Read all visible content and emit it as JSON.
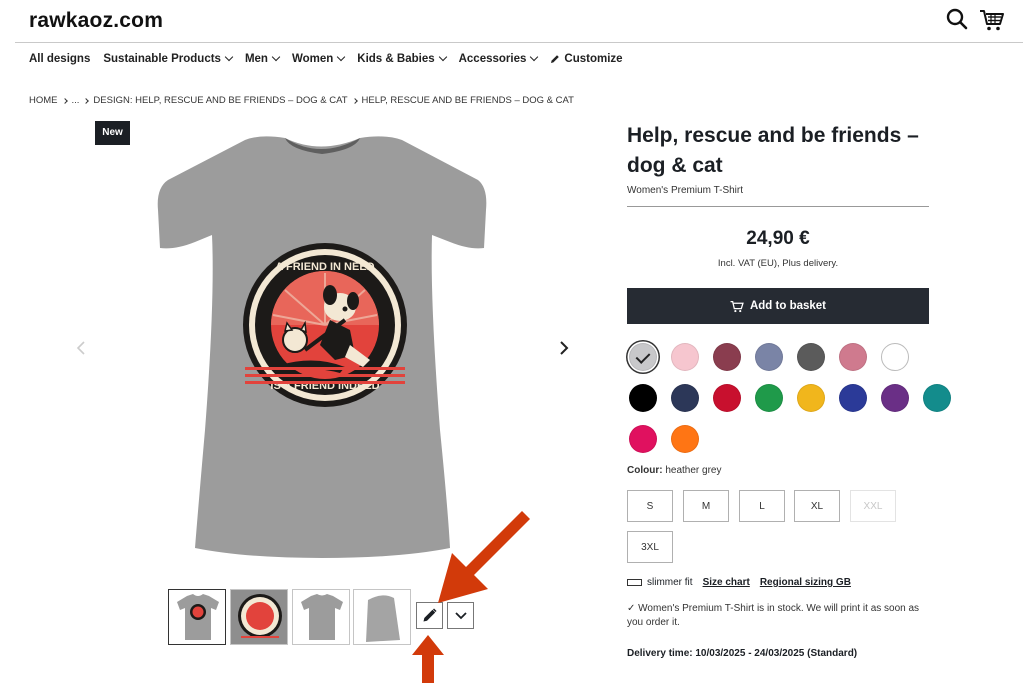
{
  "header": {
    "logo": "rawkaoz.com",
    "search_icon": "search-icon",
    "cart_icon": "cart-icon"
  },
  "nav": {
    "items": [
      {
        "label": "All designs",
        "has_chevron": false
      },
      {
        "label": "Sustainable Products",
        "has_chevron": true
      },
      {
        "label": "Men",
        "has_chevron": true
      },
      {
        "label": "Women",
        "has_chevron": true
      },
      {
        "label": "Kids & Babies",
        "has_chevron": true
      },
      {
        "label": "Accessories",
        "has_chevron": true
      },
      {
        "label": "Customize",
        "has_chevron": false,
        "icon": "pencil-icon"
      }
    ]
  },
  "breadcrumb": [
    "HOME",
    "...",
    "DESIGN: HELP, RESCUE AND BE FRIENDS – DOG & CAT",
    "HELP, RESCUE AND BE FRIENDS – DOG & CAT"
  ],
  "gallery": {
    "badge": "New",
    "design_text_top": "A FRIEND IN NEED",
    "design_text_bottom": "IS A FRIEND INDEED",
    "thumbnail_count": 4,
    "customize_icon": "pencil-icon",
    "more_icon": "chevron-down-icon"
  },
  "product": {
    "title": "Help, rescue and be friends – dog & cat",
    "subtitle": "Women's Premium T-Shirt",
    "price": "24,90 €",
    "vat_note": "Incl. VAT (EU), Plus delivery.",
    "add_to_basket": "Add to basket",
    "colour_label": "Colour:",
    "colour_value": "heather grey",
    "colors": [
      "#c8c8ca",
      "#f6c6cf",
      "#8a3d4f",
      "#7a84a6",
      "#5b5b5b",
      "#cf7a8e",
      "#ffffff",
      "#000000",
      "#2c3758",
      "#c8102e",
      "#1f9a4a",
      "#f1b61c",
      "#2b3a98",
      "#6a2f86",
      "#138c8c",
      "#e0115f",
      "#ff7514"
    ],
    "selected_color_index": 0,
    "sizes": [
      {
        "label": "S",
        "available": true
      },
      {
        "label": "M",
        "available": true
      },
      {
        "label": "L",
        "available": true
      },
      {
        "label": "XL",
        "available": true
      },
      {
        "label": "XXL",
        "available": false
      },
      {
        "label": "3XL",
        "available": true
      }
    ],
    "fit": "slimmer fit",
    "size_chart": "Size chart",
    "regional_sizing": "Regional sizing GB",
    "stock_note": "Women's Premium T-Shirt is in stock. We will print it as soon as you order it.",
    "delivery": "Delivery time: 10/03/2025 - 24/03/2025 (Standard)"
  },
  "colors": {
    "accent_dark": "#262b33",
    "annotation_arrow": "#d23a0a",
    "shirt": "#9a9a9a",
    "design_red": "#e2433c"
  }
}
